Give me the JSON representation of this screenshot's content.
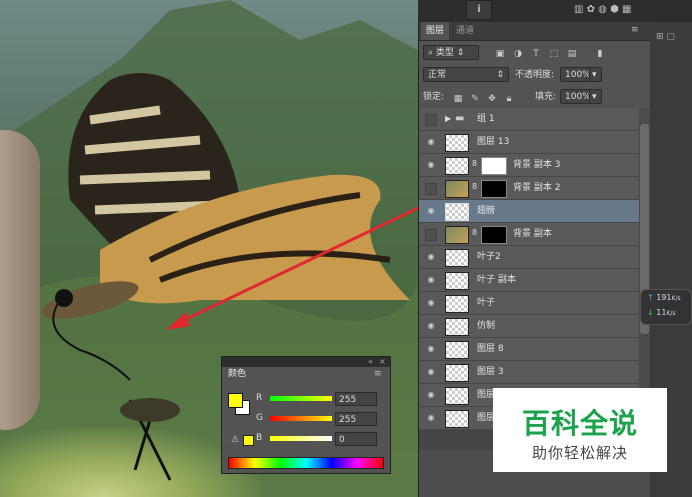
{
  "layers_panel": {
    "tabs": [
      "图层",
      "通道"
    ],
    "filter_kind": "类型",
    "blend_mode": "正常",
    "opacity_label": "不透明度:",
    "opacity_value": "100%",
    "lock_label": "锁定:",
    "fill_label": "填充:",
    "fill_value": "100%",
    "layers": [
      {
        "name": "组 1",
        "type": "group",
        "visible": false
      },
      {
        "name": "图层 13",
        "type": "layer",
        "visible": true
      },
      {
        "name": "背景 副本 3",
        "type": "masked",
        "visible": true,
        "mask": "white"
      },
      {
        "name": "背景 副本 2",
        "type": "masked",
        "visible": false,
        "mask": "black"
      },
      {
        "name": "翅膀",
        "type": "layer",
        "visible": true,
        "selected": true
      },
      {
        "name": "背景 副本",
        "type": "masked",
        "visible": false,
        "mask": "black"
      },
      {
        "name": "叶子2",
        "type": "layer",
        "visible": true
      },
      {
        "name": "叶子 副本",
        "type": "layer",
        "visible": true
      },
      {
        "name": "叶子",
        "type": "layer",
        "visible": true
      },
      {
        "name": "仿制",
        "type": "layer",
        "visible": true
      },
      {
        "name": "图层 8",
        "type": "layer",
        "visible": true
      },
      {
        "name": "图层 3",
        "type": "layer",
        "visible": true
      },
      {
        "name": "图层 2",
        "type": "layer",
        "visible": true
      },
      {
        "name": "图层",
        "type": "layer",
        "visible": true
      }
    ]
  },
  "color_panel": {
    "tab": "颜色",
    "channels": [
      {
        "label": "R",
        "value": "255"
      },
      {
        "label": "G",
        "value": "255"
      },
      {
        "label": "B",
        "value": "0"
      }
    ],
    "foreground": "#ffff00",
    "background": "#ffffff"
  },
  "network": {
    "up": "191",
    "up_unit": "K/s",
    "down": "11",
    "down_unit": "K/s"
  },
  "brand": {
    "title": "百科全说",
    "subtitle": "助你轻松解决"
  },
  "colors": {
    "accent": "#1aa34a",
    "arrow": "#e0282e",
    "selection": "#68798c"
  }
}
